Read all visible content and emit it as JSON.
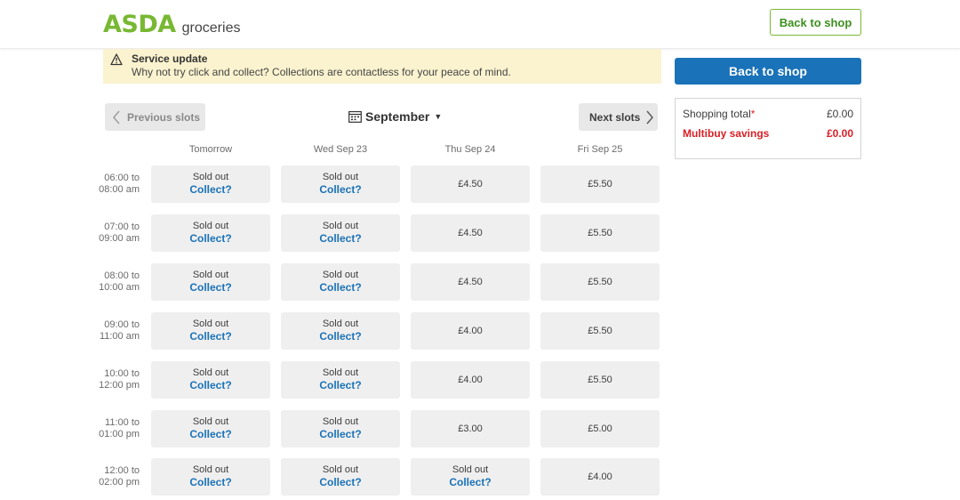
{
  "header": {
    "logo_text": "ASDA",
    "logo_sub": "groceries",
    "back_to_shop": "Back to shop"
  },
  "alert": {
    "title": "Service update",
    "message": "Why not try click and collect? Collections are contactless for your peace of mind."
  },
  "sidebar": {
    "back_to_shop": "Back to shop",
    "shopping_total_label": "Shopping total",
    "shopping_total_required": "*",
    "shopping_total_value": "£0.00",
    "multibuy_label": "Multibuy savings",
    "multibuy_value": "£0.00"
  },
  "slots_nav": {
    "previous": "Previous slots",
    "month": "September",
    "next": "Next slots"
  },
  "days": [
    "Tomorrow",
    "Wed Sep 23",
    "Thu Sep 24",
    "Fri Sep 25"
  ],
  "rows": [
    {
      "time_line1": "06:00 to",
      "time_line2": "08:00 am",
      "slots": [
        "sold",
        "sold",
        "£4.50",
        "£5.50"
      ]
    },
    {
      "time_line1": "07:00 to",
      "time_line2": "09:00 am",
      "slots": [
        "sold",
        "sold",
        "£4.50",
        "£5.50"
      ]
    },
    {
      "time_line1": "08:00 to",
      "time_line2": "10:00 am",
      "slots": [
        "sold",
        "sold",
        "£4.50",
        "£5.50"
      ]
    },
    {
      "time_line1": "09:00 to",
      "time_line2": "11:00 am",
      "slots": [
        "sold",
        "sold",
        "£4.00",
        "£5.50"
      ]
    },
    {
      "time_line1": "10:00 to",
      "time_line2": "12:00 pm",
      "slots": [
        "sold",
        "sold",
        "£4.00",
        "£5.50"
      ]
    },
    {
      "time_line1": "11:00 to",
      "time_line2": "01:00 pm",
      "slots": [
        "sold",
        "sold",
        "£3.00",
        "£5.00"
      ]
    },
    {
      "time_line1": "12:00 to",
      "time_line2": "02:00 pm",
      "slots": [
        "sold",
        "sold",
        "sold",
        "£4.00"
      ]
    }
  ],
  "sold_out_text": "Sold out",
  "collect_text": "Collect?",
  "icons": {
    "warning": "warning-icon",
    "calendar": "calendar-icon",
    "prev": "chevron-left-icon",
    "next": "chevron-right-icon",
    "caret": "caret-down-icon"
  },
  "colors": {
    "brand_green": "#78b833",
    "primary_blue": "#1a72b8",
    "alert_bg": "#fbf3cf",
    "savings_red": "#d91f26",
    "slot_bg": "#efefef"
  }
}
